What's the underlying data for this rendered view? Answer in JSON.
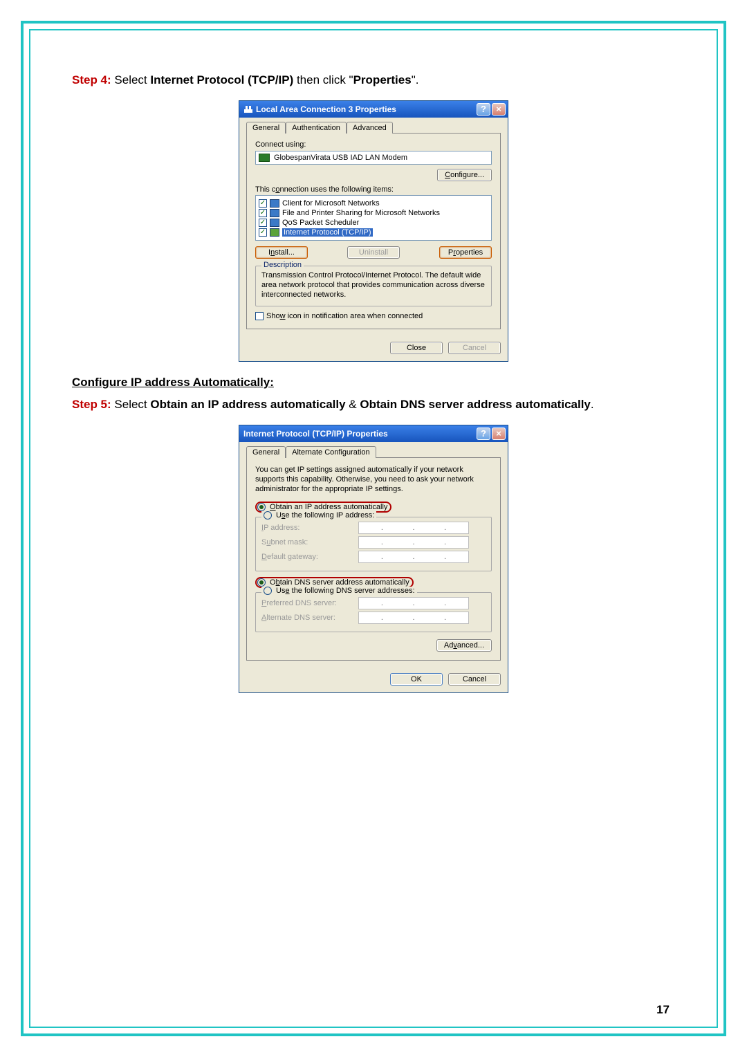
{
  "page_number": "17",
  "step4": {
    "label": "Step 4:",
    "pre": " Select ",
    "bold1": "Internet Protocol (TCP/IP)",
    "mid": " then click \"",
    "bold2": "Properties",
    "post": "\"."
  },
  "section_heading": "Configure IP address Automatically:",
  "step5": {
    "label": "Step 5:",
    "pre": " Select ",
    "bold1": "Obtain an IP address automatically",
    "amp": " & ",
    "bold2": "Obtain DNS server address automatically",
    "post": "."
  },
  "dlg1": {
    "title": "Local Area Connection 3 Properties",
    "tabs": [
      "General",
      "Authentication",
      "Advanced"
    ],
    "connect_using_label": "Connect using:",
    "adapter": "GlobespanVirata USB IAD LAN Modem",
    "configure_btn": "Configure...",
    "items_label": "This connection uses the following items:",
    "items": [
      "Client for Microsoft Networks",
      "File and Printer Sharing for Microsoft Networks",
      "QoS Packet Scheduler",
      "Internet Protocol (TCP/IP)"
    ],
    "install_btn": "Install...",
    "uninstall_btn": "Uninstall",
    "properties_btn": "Properties",
    "description_label": "Description",
    "description_text": "Transmission Control Protocol/Internet Protocol. The default wide area network protocol that provides communication across diverse interconnected networks.",
    "show_icon_label": "Show icon in notification area when connected",
    "close_btn": "Close",
    "cancel_btn": "Cancel"
  },
  "dlg2": {
    "title": "Internet Protocol (TCP/IP) Properties",
    "tabs": [
      "General",
      "Alternate Configuration"
    ],
    "intro": "You can get IP settings assigned automatically if your network supports this capability. Otherwise, you need to ask your network administrator for the appropriate IP settings.",
    "radio_obtain_ip": "Obtain an IP address automatically",
    "radio_use_ip": "Use the following IP address:",
    "ip_address_label": "IP address:",
    "subnet_label": "Subnet mask:",
    "gateway_label": "Default gateway:",
    "radio_obtain_dns": "Obtain DNS server address automatically",
    "radio_use_dns": "Use the following DNS server addresses:",
    "pref_dns_label": "Preferred DNS server:",
    "alt_dns_label": "Alternate DNS server:",
    "advanced_btn": "Advanced...",
    "ok_btn": "OK",
    "cancel_btn": "Cancel"
  }
}
